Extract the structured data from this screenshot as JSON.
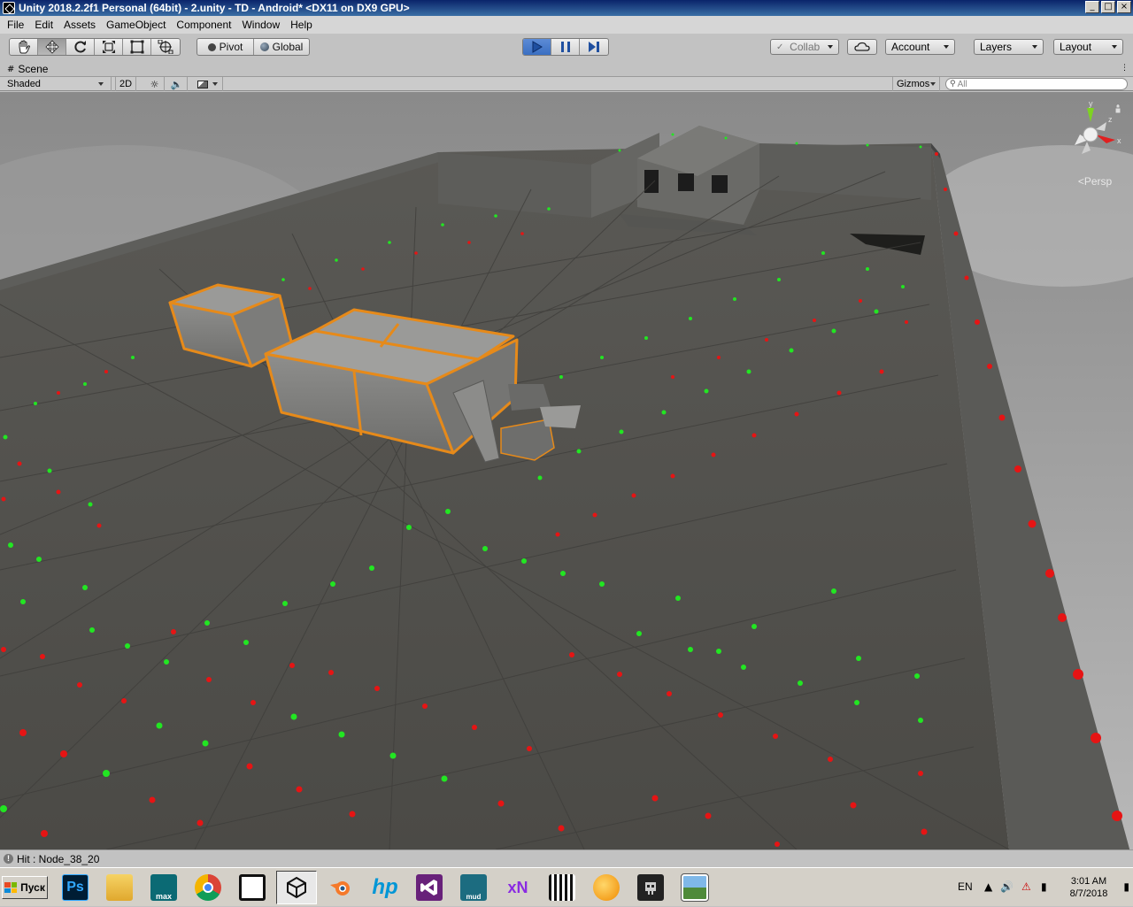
{
  "window": {
    "title": "Unity 2018.2.2f1 Personal (64bit) - 2.unity - TD - Android* <DX11 on DX9 GPU>",
    "minimize": "_",
    "maximize": "□",
    "close": "×"
  },
  "menu": [
    "File",
    "Edit",
    "Assets",
    "GameObject",
    "Component",
    "Window",
    "Help"
  ],
  "toolbar": {
    "tools": [
      "hand-tool-icon",
      "move-tool-icon",
      "rotate-tool-icon",
      "scale-tool-icon",
      "rect-tool-icon",
      "transform-tool-icon"
    ],
    "pivot_label": "Pivot",
    "global_label": "Global",
    "collab_label": "Collab",
    "account_label": "Account",
    "layers_label": "Layers",
    "layout_label": "Layout"
  },
  "scene": {
    "tab_label": "Scene",
    "shading_mode": "Shaded",
    "mode_2d": "2D",
    "gizmos_label": "Gizmos",
    "search_placeholder": "All",
    "projection_label": "Persp",
    "axis_y": "y",
    "axis_z": "z",
    "axis_x": "x"
  },
  "status": {
    "message": "Hit : Node_38_20"
  },
  "taskbar": {
    "start_label": "Пуск",
    "apps": [
      {
        "name": "photoshop",
        "label": "Ps"
      },
      {
        "name": "file-explorer",
        "label": ""
      },
      {
        "name": "3ds-max",
        "label": "max"
      },
      {
        "name": "chrome",
        "label": ""
      },
      {
        "name": "unity-hub",
        "label": ""
      },
      {
        "name": "unity",
        "label": ""
      },
      {
        "name": "blender",
        "label": ""
      },
      {
        "name": "hp",
        "label": "hp"
      },
      {
        "name": "visual-studio",
        "label": ""
      },
      {
        "name": "mudbox",
        "label": "mud"
      },
      {
        "name": "xnormal",
        "label": "xN"
      },
      {
        "name": "fl-studio-keys",
        "label": ""
      },
      {
        "name": "fl-studio",
        "label": ""
      },
      {
        "name": "app-robot",
        "label": ""
      },
      {
        "name": "image-viewer",
        "label": ""
      }
    ],
    "language": "EN",
    "time": "3:01 AM",
    "date": "8/7/2018"
  },
  "colors": {
    "node_green": "#22e622",
    "node_red": "#e61414",
    "box_outline": "#e68a1a",
    "play_active": "#3a6fc2"
  }
}
